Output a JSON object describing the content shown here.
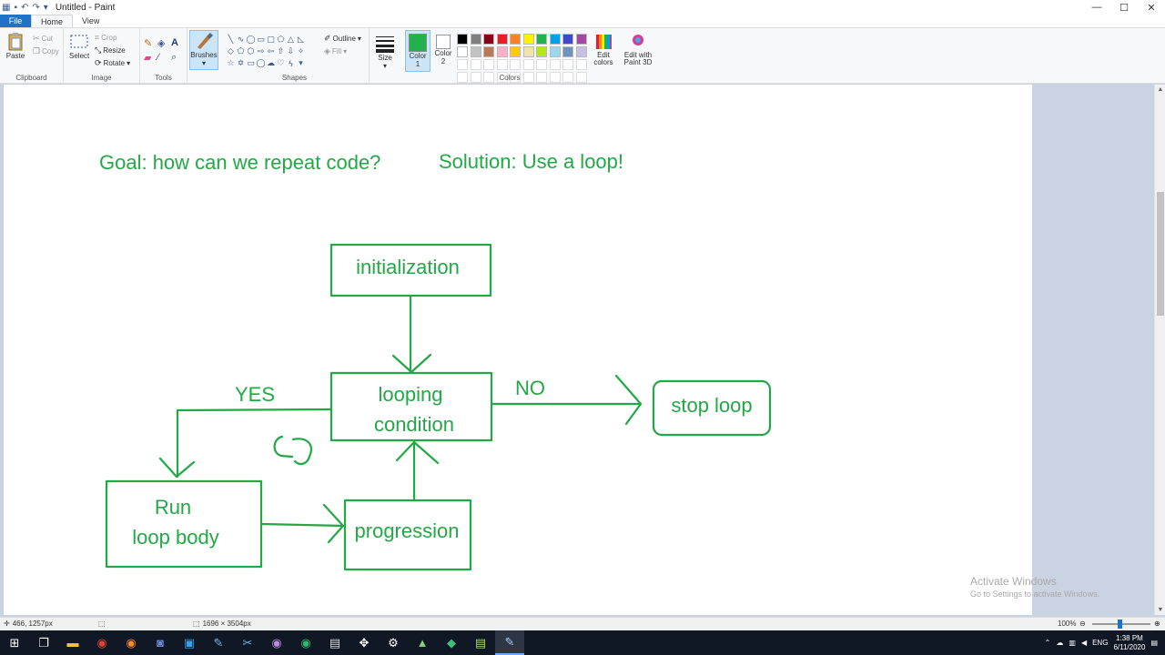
{
  "window": {
    "title": "Untitled - Paint",
    "controls": {
      "minimize": "—",
      "maximize": "☐",
      "close": "✕"
    }
  },
  "tabs": [
    "File",
    "Home",
    "View"
  ],
  "ribbon": {
    "clipboard": {
      "label": "Clipboard",
      "paste": "Paste",
      "cut": "Cut",
      "copy": "Copy"
    },
    "image": {
      "label": "Image",
      "select": "Select",
      "crop": "Crop",
      "resize": "Resize",
      "rotate": "Rotate"
    },
    "tools": {
      "label": "Tools"
    },
    "brushes": {
      "label": "Brushes"
    },
    "shapes": {
      "label": "Shapes",
      "outline": "Outline",
      "fill": "Fill"
    },
    "size": {
      "label": "Size"
    },
    "color1": {
      "label": "Color",
      "sub": "1"
    },
    "color2": {
      "label": "Color",
      "sub": "2"
    },
    "colors": {
      "label": "Colors",
      "edit": "Edit colors",
      "paint3d": "Edit with Paint 3D"
    }
  },
  "palette_row1": [
    "#000000",
    "#7f7f7f",
    "#880015",
    "#ed1c24",
    "#ff7f27",
    "#fff200",
    "#22b14c",
    "#00a2e8",
    "#3f48cc",
    "#a349a4"
  ],
  "palette_row2": [
    "#ffffff",
    "#c3c3c3",
    "#b97a57",
    "#ffaec9",
    "#ffc90e",
    "#efe4b0",
    "#b5e61d",
    "#99d9ea",
    "#7092be",
    "#c8bfe7"
  ],
  "selected_color": "#22b14c",
  "drawing": {
    "goal": "Goal: how can we repeat code?",
    "solution": "Solution: Use a loop!",
    "initialization": "initialization",
    "looping1": "looping",
    "looping2": "condition",
    "stop": "stop loop",
    "run1": "Run",
    "run2": "loop body",
    "progression": "progression",
    "yes": "YES",
    "no": "NO",
    "ink": "#22a845"
  },
  "watermark": {
    "line1": "Activate Windows",
    "line2": "Go to Settings to activate Windows."
  },
  "status": {
    "cursor": "466, 1257px",
    "size": "1696 × 3504px",
    "zoom": "100%"
  },
  "clock": {
    "time": "1:38 PM",
    "date": "6/11/2020"
  },
  "tray": {
    "lang": "ENG"
  }
}
